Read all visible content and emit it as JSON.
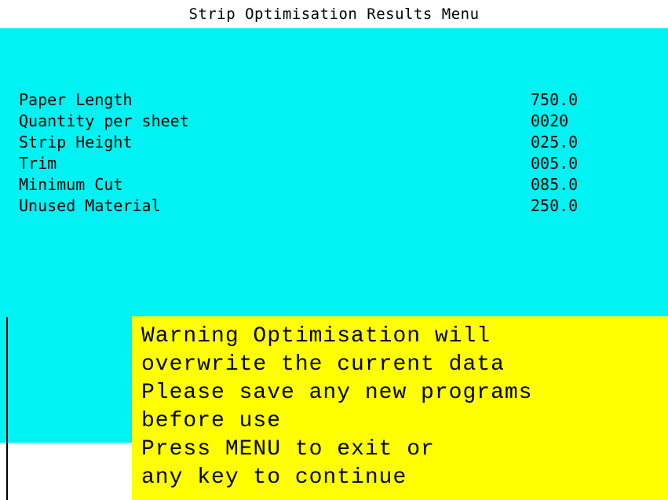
{
  "window": {
    "title": "Strip Optimisation Results Menu"
  },
  "results": [
    {
      "label": "Paper Length",
      "value": "750.0"
    },
    {
      "label": "Quantity per sheet",
      "value": "0020"
    },
    {
      "label": "Strip Height",
      "value": "025.0"
    },
    {
      "label": "Trim",
      "value": "005.0"
    },
    {
      "label": "Minimum Cut",
      "value": "085.0"
    },
    {
      "label": "Unused Material",
      "value": "250.0"
    }
  ],
  "warning": {
    "lines": [
      "Warning Optimisation will",
      "overwrite the current data",
      "Please save any new programs",
      "before use",
      "Press MENU to exit or",
      "any key to continue"
    ]
  },
  "colors": {
    "panel": "#00f2f2",
    "warning_background": "#ffff00",
    "text": "#000000"
  }
}
